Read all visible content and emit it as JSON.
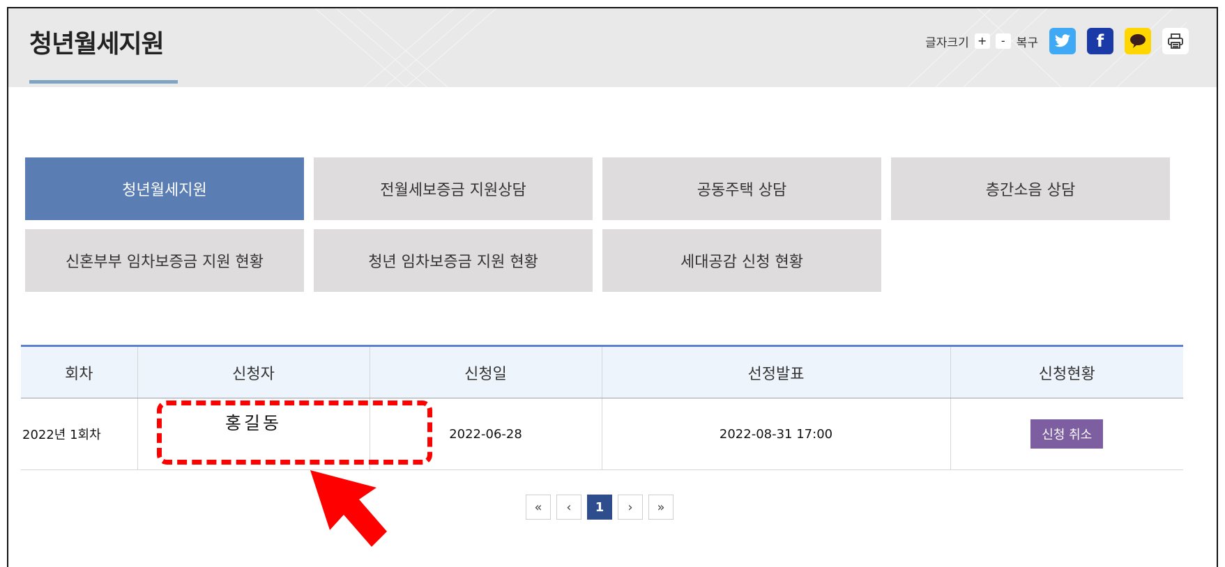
{
  "header": {
    "title": "청년월세지원",
    "font_size_label": "글자크기",
    "plus": "+",
    "minus": "-",
    "reset": "복구",
    "sns": [
      "twitter-icon",
      "facebook-icon",
      "kakao-icon",
      "print-icon"
    ],
    "facebook_glyph": "f"
  },
  "menu": {
    "items": [
      {
        "label": "청년월세지원",
        "active": true
      },
      {
        "label": "전월세보증금 지원상담",
        "active": false
      },
      {
        "label": "공동주택 상담",
        "active": false
      },
      {
        "label": "층간소음 상담",
        "active": false
      },
      {
        "label": "신혼부부 임차보증금 지원 현황",
        "active": false
      },
      {
        "label": "청년 임차보증금 지원 현황",
        "active": false
      },
      {
        "label": "세대공감 신청 현황",
        "active": false
      }
    ]
  },
  "table": {
    "headers": [
      "회차",
      "신청자",
      "신청일",
      "선정발표",
      "신청현황"
    ],
    "rows": [
      {
        "round": "2022년 1회차",
        "applicant": "홍길동",
        "applied_date": "2022-06-28",
        "announcement": "2022-08-31 17:00",
        "action": "신청 취소"
      }
    ]
  },
  "pagination": {
    "first": "«",
    "prev": "‹",
    "current": "1",
    "next": "›",
    "last": "»"
  },
  "colors": {
    "active_menu": "#5a7db3",
    "cancel_button": "#7d5ea1",
    "highlight": "#ff0000"
  }
}
